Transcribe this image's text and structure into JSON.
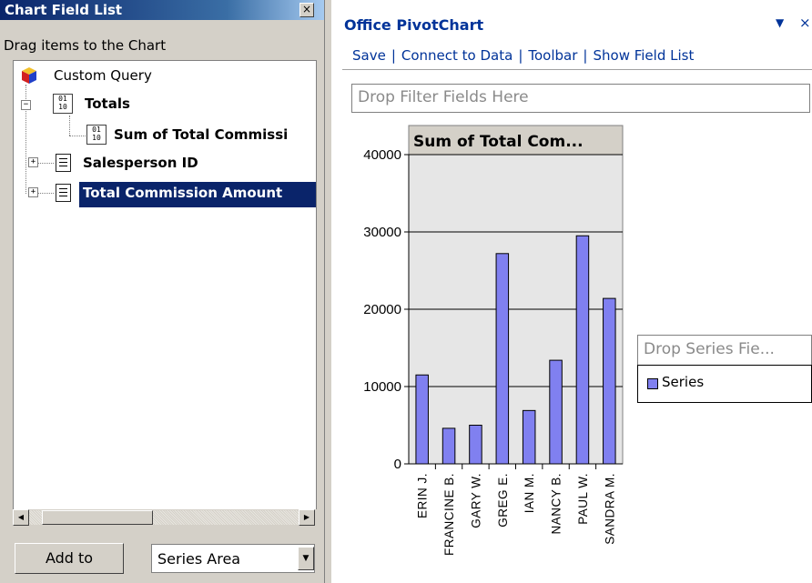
{
  "field_list": {
    "title": "Chart Field List",
    "close_glyph": "×",
    "instruction": "Drag items to the Chart",
    "tree": {
      "root": "Custom Query",
      "totals": "Totals",
      "binary_icon_text": "01\n10",
      "sum_item": "Sum of Total Commissi",
      "salesperson": "Salesperson ID",
      "total_commission": "Total Commission Amount"
    },
    "expanders": {
      "collapse": "−",
      "expand": "+"
    },
    "add_to_label": "Add to",
    "area_value": "Series Area",
    "icons": {
      "title_close": "close-icon",
      "root": "custom-query-cube-icon",
      "binary": "totals-binary-icon",
      "field": "field-list-icon",
      "scroll_left": "scroll-left-arrow-icon",
      "scroll_right": "scroll-right-arrow-icon",
      "dropdown": "chevron-down-icon"
    }
  },
  "pivot_chart": {
    "title": "Office PivotChart",
    "caret": "▼",
    "close": "×",
    "menu": [
      "Save",
      "Connect to Data",
      "Toolbar",
      "Show Field List"
    ],
    "menu_separator": "|",
    "drop_filter": "Drop Filter Fields Here",
    "drop_series": "Drop Series Fie...",
    "legend_label": "Series",
    "colors": {
      "accent": "#003399",
      "bar": "#8080f0",
      "plot_bg": "#e6e6e6"
    }
  },
  "chart_data": {
    "type": "bar",
    "title": "Sum of Total Com...",
    "categories": [
      "ERIN J.",
      "FRANCINE B.",
      "GARY W.",
      "GREG E.",
      "IAN M.",
      "NANCY B.",
      "PAUL W.",
      "SANDRA M."
    ],
    "series": [
      {
        "name": "Series",
        "values": [
          11500,
          4600,
          5000,
          27200,
          6900,
          13400,
          29500,
          21400
        ]
      }
    ],
    "yticks": [
      0,
      10000,
      20000,
      30000,
      40000
    ],
    "ylim": [
      0,
      40000
    ],
    "grid": true,
    "legend_position": "right"
  }
}
